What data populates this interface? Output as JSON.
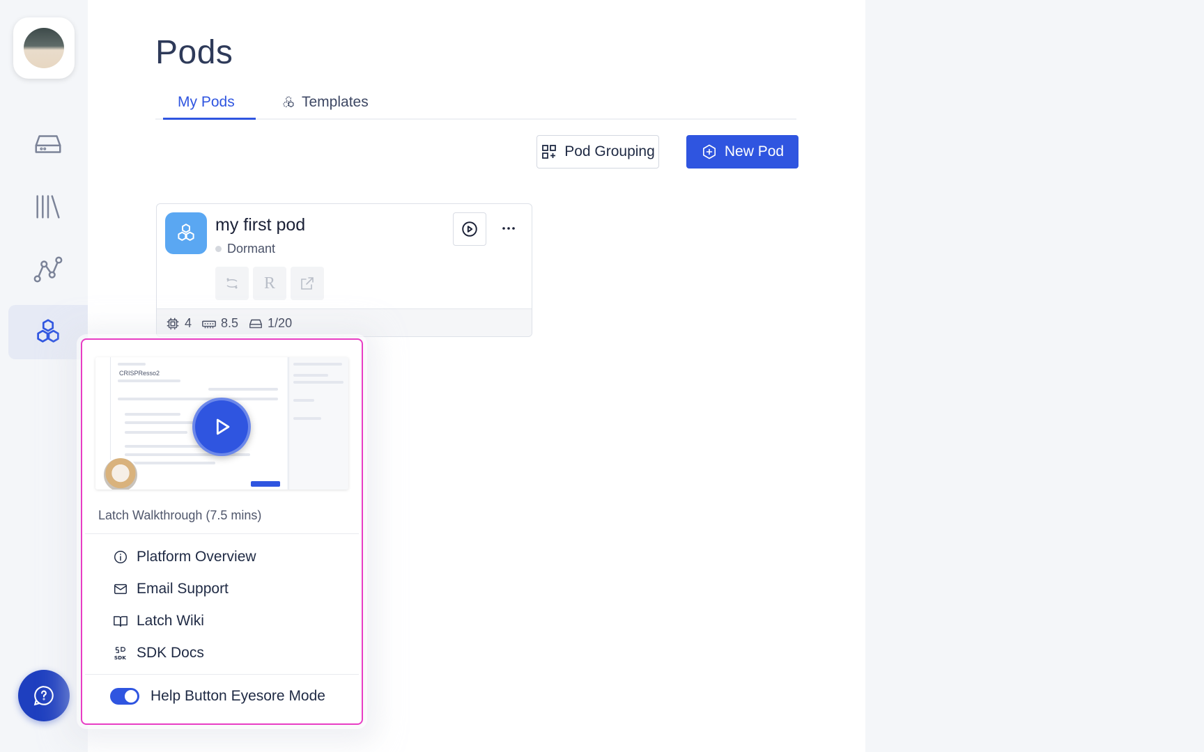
{
  "sidebar": {
    "avatar": "user-avatar",
    "items": [
      {
        "name": "storage",
        "icon": "hard-drive-icon",
        "active": false
      },
      {
        "name": "library",
        "icon": "library-icon",
        "active": false
      },
      {
        "name": "workflows",
        "icon": "graph-nodes-icon",
        "active": false
      },
      {
        "name": "pods",
        "icon": "hexagon-cluster-icon",
        "active": true
      }
    ],
    "help_icon": "help-chat-icon"
  },
  "page": {
    "title": "Pods",
    "tabs": [
      {
        "label": "My Pods",
        "active": true
      },
      {
        "label": "Templates",
        "active": false
      }
    ],
    "pod_grouping_label": "Pod Grouping",
    "new_pod_label": "New Pod"
  },
  "pod": {
    "name": "my first pod",
    "status": "Dormant",
    "tool_r_label": "R",
    "cpu": "4",
    "memory": "8.5",
    "storage": "1/20"
  },
  "help_popup": {
    "video_caption": "Latch Walkthrough (7.5 mins)",
    "thumb_title": "CRISPResso2",
    "items": [
      {
        "label": "Platform Overview",
        "icon": "info-icon"
      },
      {
        "label": "Email Support",
        "icon": "mail-icon"
      },
      {
        "label": "Latch Wiki",
        "icon": "book-icon"
      },
      {
        "label": "SDK Docs",
        "icon": "sdk-icon"
      }
    ],
    "toggle_label": "Help Button Eyesore Mode",
    "toggle_on": true
  },
  "colors": {
    "accent": "#2f55e0",
    "highlight_border": "#e83dc4",
    "help_fab": "#1e3fbf"
  }
}
